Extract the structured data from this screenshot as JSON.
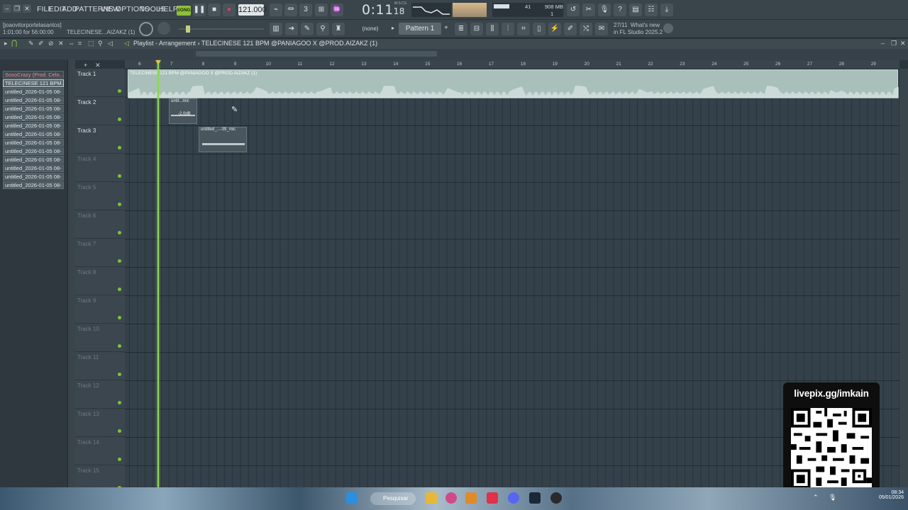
{
  "menu": [
    "FILE",
    "EDIT",
    "ADD",
    "PATTERNS",
    "VIEW",
    "OPTIONS",
    "TOOLS",
    "HELP"
  ],
  "transport": {
    "song_label": "SONG",
    "tempo": "121.000",
    "time_main": "0:11",
    "time_sub": "18",
    "mcs_label": "M:S:CS",
    "cpu_value": "41",
    "memory": "908 MB",
    "mem_voices": "1"
  },
  "hint": {
    "user": "[joaovitorportelasantos]",
    "duration": "1:01:00 for 56:00:00",
    "project": "TELECINESE...AIZAKZ (1)"
  },
  "news": {
    "date": "27/11",
    "title": "What's new",
    "subtitle": "in FL Studio 2025.2"
  },
  "pattern": {
    "none_label": "(none)",
    "pattern_label": "Pattern 1"
  },
  "browser": {
    "items": [
      {
        "label": "SosoCrazy (Prod. Celo...",
        "style": "red"
      },
      {
        "label": "TELECINESE 121 BPM...",
        "style": "sel"
      },
      {
        "label": "untitled_2026-01-05 08-",
        "style": "normal"
      },
      {
        "label": "untitled_2026-01-05 08-",
        "style": "normal"
      },
      {
        "label": "untitled_2026-01-05 08-",
        "style": "normal"
      },
      {
        "label": "untitled_2026-01-05 08-",
        "style": "normal"
      },
      {
        "label": "untitled_2026-01-05 08-",
        "style": "normal"
      },
      {
        "label": "untitled_2026-01-05 08-",
        "style": "normal"
      },
      {
        "label": "untitled_2026-01-05 08-",
        "style": "normal"
      },
      {
        "label": "untitled_2026-01-05 08-",
        "style": "normal"
      },
      {
        "label": "untitled_2026-01-05 08-",
        "style": "normal"
      },
      {
        "label": "untitled_2026-01-05 08-",
        "style": "normal"
      },
      {
        "label": "untitled_2026-01-05 08-",
        "style": "normal"
      },
      {
        "label": "untitled_2026-01-05 08-",
        "style": "normal"
      }
    ]
  },
  "playlist": {
    "title": "Playlist - Arrangement",
    "separator": "›",
    "clip_name": "TELECINESE 121 BPM @PANIAGOO X @PROD.AIZAKZ (1)",
    "ruler": [
      "6",
      "7",
      "8",
      "9",
      "10",
      "11",
      "12",
      "13",
      "14",
      "15",
      "16",
      "17",
      "18",
      "19",
      "20",
      "21",
      "22",
      "23",
      "24",
      "25",
      "26",
      "27",
      "28",
      "29"
    ],
    "tracks": [
      {
        "name": "Track 1",
        "dim": false
      },
      {
        "name": "Track 2",
        "dim": false
      },
      {
        "name": "Track 3",
        "dim": false
      },
      {
        "name": "Track 4",
        "dim": true
      },
      {
        "name": "Track 5",
        "dim": true
      },
      {
        "name": "Track 6",
        "dim": true
      },
      {
        "name": "Track 7",
        "dim": true
      },
      {
        "name": "Track 8",
        "dim": true
      },
      {
        "name": "Track 9",
        "dim": true
      },
      {
        "name": "Track 10",
        "dim": true
      },
      {
        "name": "Track 11",
        "dim": true
      },
      {
        "name": "Track 12",
        "dim": true
      },
      {
        "name": "Track 13",
        "dim": true
      },
      {
        "name": "Track 14",
        "dim": true
      },
      {
        "name": "Track 15",
        "dim": true
      }
    ],
    "clips": {
      "main_label": "TELECINESE 121 BPM @PANIAGOO X @PROD.AIZAKZ (1)",
      "clip2_label": "untit...mic",
      "clip2_gain": "-2.0dB",
      "clip3_label": "untitled_...-39_mic"
    }
  },
  "overlay": {
    "url": "livepix.gg/imkain"
  },
  "taskbar": {
    "search": "Pesquisar",
    "time": "08:34",
    "date": "05/01/2026"
  },
  "colors": {
    "accent_green": "#8cd65a",
    "song_green": "#8fbf3a",
    "clip_fill": "#a9c0ba",
    "grid_bg": "#34414a"
  }
}
